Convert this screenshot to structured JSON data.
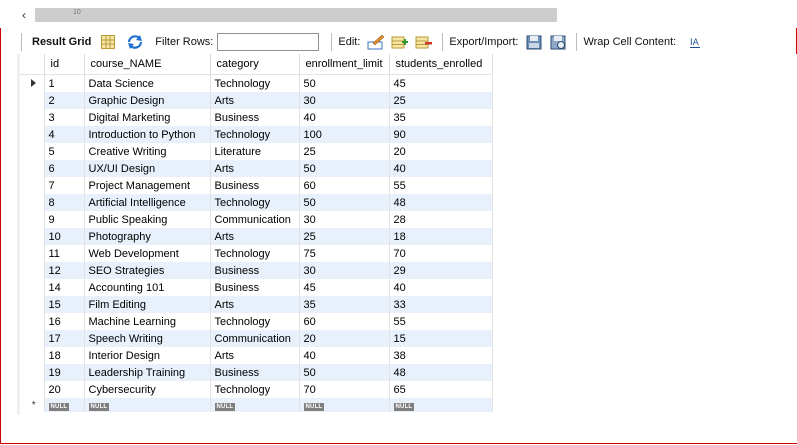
{
  "top": {
    "scroll_label": "10"
  },
  "toolbar": {
    "result_grid": "Result Grid",
    "filter_rows": "Filter Rows:",
    "filter_value": "",
    "edit": "Edit:",
    "export_import": "Export/Import:",
    "wrap_cell": "Wrap Cell Content:"
  },
  "grid": {
    "columns": [
      "id",
      "course_NAME",
      "category",
      "enrollment_limit",
      "students_enrolled"
    ],
    "rows": [
      [
        "1",
        "Data Science",
        "Technology",
        "50",
        "45"
      ],
      [
        "2",
        "Graphic Design",
        "Arts",
        "30",
        "25"
      ],
      [
        "3",
        "Digital Marketing",
        "Business",
        "40",
        "35"
      ],
      [
        "4",
        "Introduction to Python",
        "Technology",
        "100",
        "90"
      ],
      [
        "5",
        "Creative Writing",
        "Literature",
        "25",
        "20"
      ],
      [
        "6",
        "UX/UI Design",
        "Arts",
        "50",
        "40"
      ],
      [
        "7",
        "Project Management",
        "Business",
        "60",
        "55"
      ],
      [
        "8",
        "Artificial Intelligence",
        "Technology",
        "50",
        "48"
      ],
      [
        "9",
        "Public Speaking",
        "Communication",
        "30",
        "28"
      ],
      [
        "10",
        "Photography",
        "Arts",
        "25",
        "18"
      ],
      [
        "11",
        "Web Development",
        "Technology",
        "75",
        "70"
      ],
      [
        "12",
        "SEO Strategies",
        "Business",
        "30",
        "29"
      ],
      [
        "14",
        "Accounting 101",
        "Business",
        "45",
        "40"
      ],
      [
        "15",
        "Film Editing",
        "Arts",
        "35",
        "33"
      ],
      [
        "16",
        "Machine Learning",
        "Technology",
        "60",
        "55"
      ],
      [
        "17",
        "Speech Writing",
        "Communication",
        "20",
        "15"
      ],
      [
        "18",
        "Interior Design",
        "Arts",
        "40",
        "38"
      ],
      [
        "19",
        "Leadership Training",
        "Business",
        "50",
        "48"
      ],
      [
        "20",
        "Cybersecurity",
        "Technology",
        "70",
        "65"
      ]
    ],
    "null_label": "NULL",
    "new_row_marker": "*"
  },
  "colors": {
    "row_alt": "#e8f0fb",
    "frame_border": "#cc0000"
  }
}
